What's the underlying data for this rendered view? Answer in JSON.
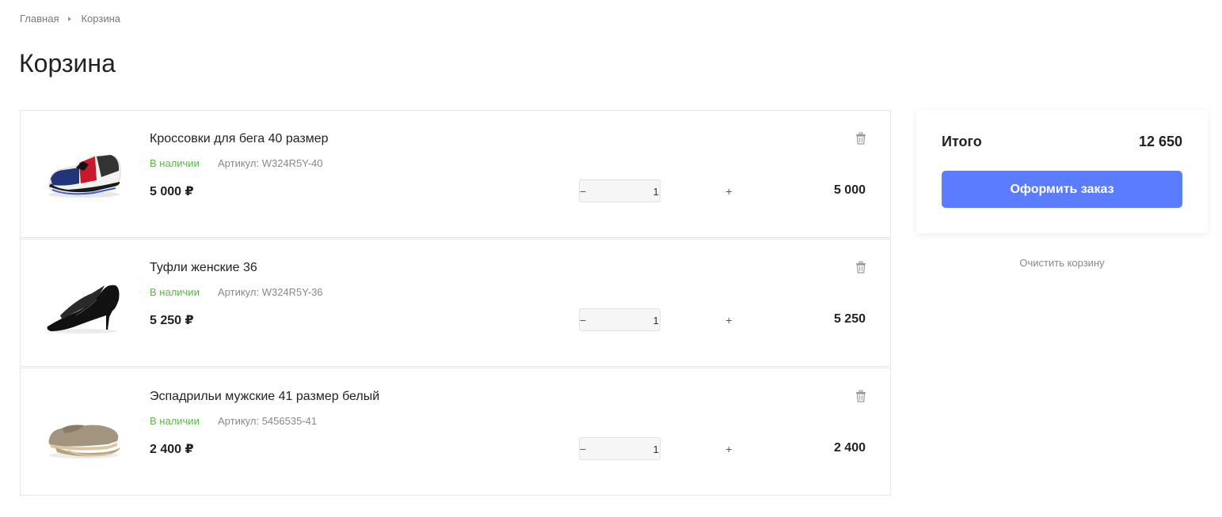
{
  "breadcrumb": {
    "home": "Главная",
    "current": "Корзина"
  },
  "page_title": "Корзина",
  "items": [
    {
      "name": "Кроссовки для бега 40 размер",
      "stock": "В наличии",
      "sku": "Артикул: W324R5Y-40",
      "price": "5 000 ₽",
      "qty": "1",
      "total": "5 000",
      "image": "running-sneaker-icon"
    },
    {
      "name": "Туфли женские 36",
      "stock": "В наличии",
      "sku": "Артикул: W324R5Y-36",
      "price": "5 250 ₽",
      "qty": "1",
      "total": "5 250",
      "image": "high-heel-shoe-icon"
    },
    {
      "name": "Эспадрильи мужские 41 размер белый",
      "stock": "В наличии",
      "sku": "Артикул: 5456535-41",
      "price": "2 400 ₽",
      "qty": "1",
      "total": "2 400",
      "image": "espadrille-shoe-icon"
    }
  ],
  "qty_controls": {
    "minus": "−",
    "plus": "+"
  },
  "summary": {
    "label": "Итого",
    "amount": "12 650",
    "checkout": "Оформить заказ"
  },
  "clear_cart": "Очистить корзину",
  "colors": {
    "accent": "#5b7cff",
    "in_stock": "#5bb54a"
  }
}
